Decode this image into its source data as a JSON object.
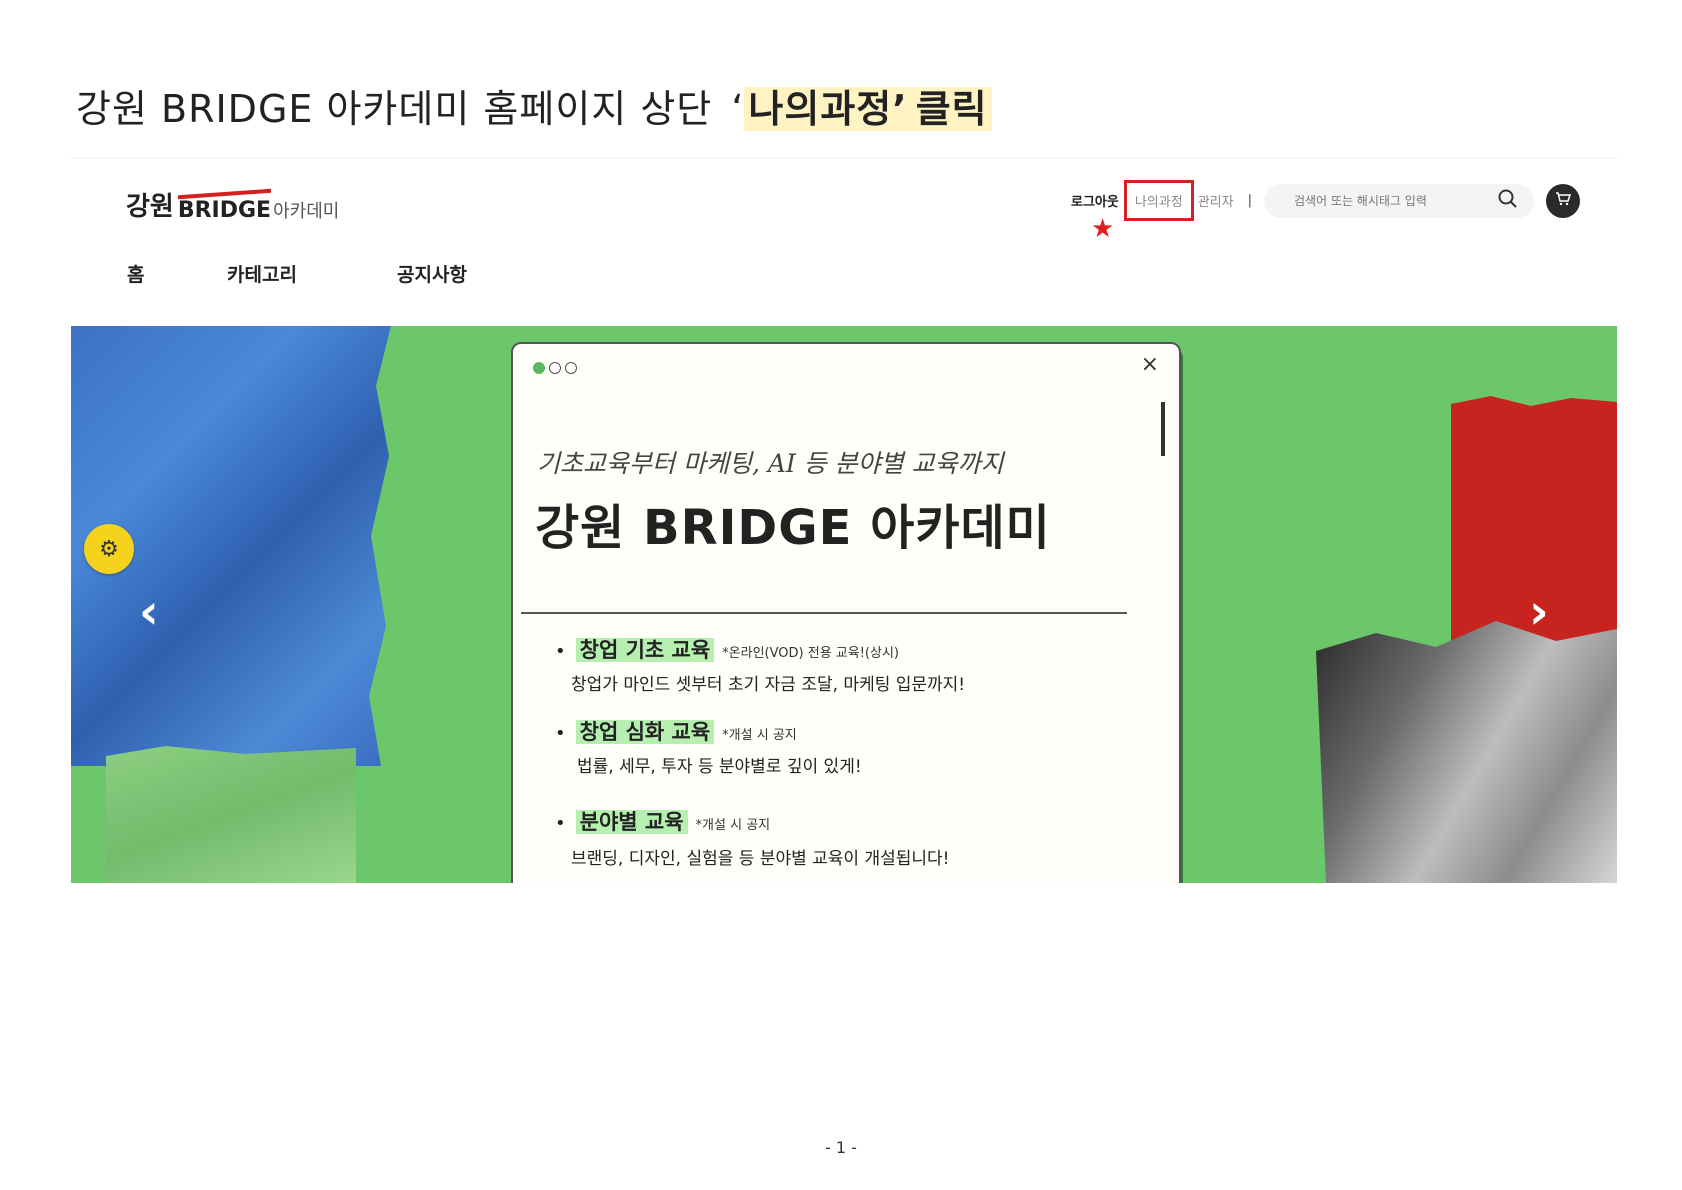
{
  "doc": {
    "heading_prefix": "강원 BRIDGE 아카데미 홈페이지 상단",
    "heading_quote_open": "‘",
    "heading_highlight": "나의과정’",
    "heading_suffix": "클릭",
    "page_number": "- 1 -"
  },
  "site": {
    "logo_ko": "강원",
    "logo_en": "BRIDGE",
    "logo_academy": "아카데미",
    "top_links": {
      "logout": "로그아웃",
      "my_course": "나의과정",
      "admin": "관리자",
      "separator": "|"
    },
    "search": {
      "placeholder": "검색어 또는 해시태그 입력",
      "icon": "search-icon"
    },
    "cart_icon": "cart-icon",
    "annotation_mark": "★",
    "main_nav": [
      "홈",
      "카테고리",
      "공지사항"
    ]
  },
  "hero": {
    "colors": {
      "background": "#6cc66a",
      "highlight": "#b6efb0",
      "annotation": "#d42020"
    },
    "left_arrow": "‹",
    "right_arrow": "›",
    "badge_icon": "gear-icon",
    "card": {
      "close": "×",
      "subtitle": "기초교육부터 마케팅, AI 등 분야별 교육까지",
      "title": "강원 BRIDGE 아카데미",
      "items": [
        {
          "name": "창업 기초 교육",
          "note": "*온라인(VOD) 전용 교육!(상시)",
          "desc": "창업가 마인드 셋부터 초기 자금 조달, 마케팅 입문까지!"
        },
        {
          "name": "창업 심화 교육",
          "note": "*개설 시 공지",
          "desc": "법률, 세무, 투자 등 분야별로 깊이 있게!"
        },
        {
          "name": "분야별 교육",
          "note": "*개설 시 공지",
          "desc": "브랜딩, 디자인, 실험을 등 분야별 교육이 개설됩니다!"
        }
      ]
    }
  }
}
